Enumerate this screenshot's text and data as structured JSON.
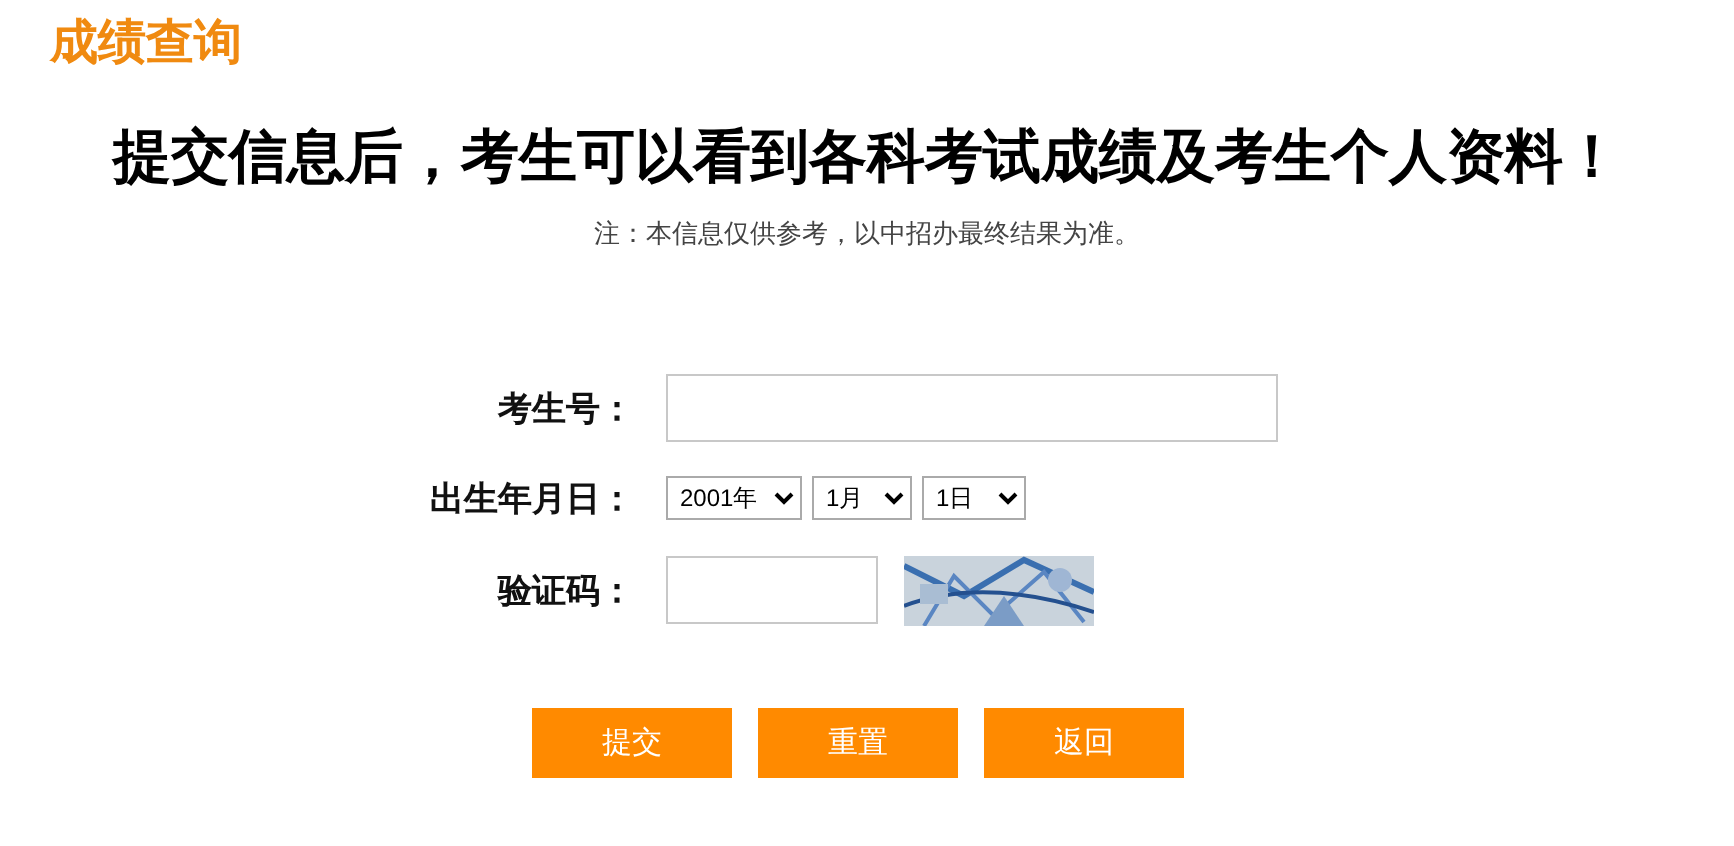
{
  "page_title": "成绩查询",
  "headline": "提交信息后，考生可以看到各科考试成绩及考生个人资料！",
  "note": "注：本信息仅供参考，以中招办最终结果为准。",
  "form": {
    "fields": [
      {
        "kind": "text",
        "label": "考生号："
      },
      {
        "kind": "date",
        "label": "出生年月日：",
        "selects": [
          "2001年",
          "1月",
          "1日"
        ]
      },
      {
        "kind": "captcha",
        "label": "验证码："
      }
    ]
  },
  "buttons": [
    "提交",
    "重置",
    "返回"
  ]
}
